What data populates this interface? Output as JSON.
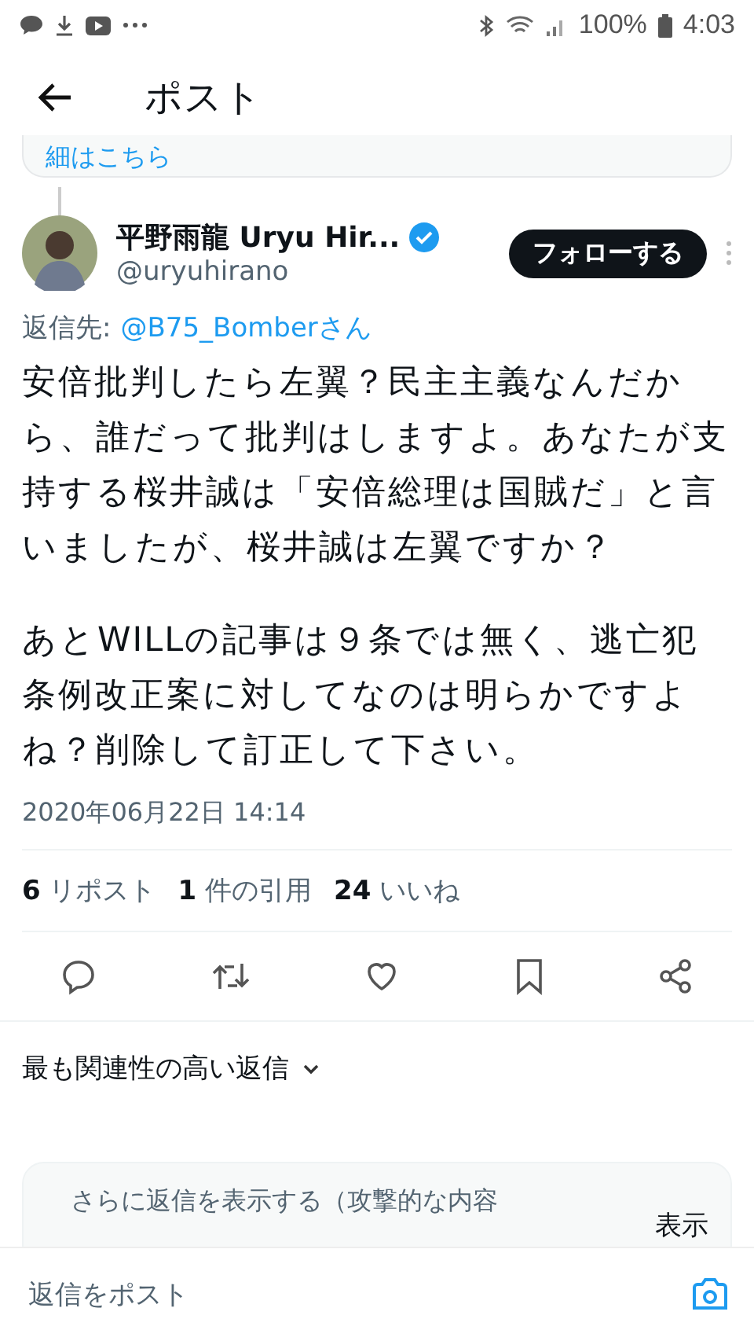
{
  "status_bar": {
    "time": "4:03",
    "battery": "100%"
  },
  "header": {
    "title": "ポスト"
  },
  "previous_card": {
    "link_text": "細はこちら"
  },
  "post": {
    "author_name": "平野雨龍 Uryu Hir...",
    "verified": true,
    "handle": "@uryuhirano",
    "follow_button": "フォローする",
    "reply_to_label": "返信先:",
    "reply_to_user": "@B75_Bomberさん",
    "paragraphs": [
      "安倍批判したら左翼？民主主義なんだから、誰だって批判はしますよ。あなたが支持する桜井誠は「安倍総理は国賊だ」と言いましたが、桜井誠は左翼ですか？",
      "あとWILLの記事は９条では無く、逃亡犯条例改正案に対してなのは明らかですよね？削除して訂正して下さい。"
    ],
    "timestamp": "2020年06月22日 14:14",
    "stats": [
      {
        "count": "6",
        "label": "リポスト"
      },
      {
        "count": "1",
        "label": "件の引用"
      },
      {
        "count": "24",
        "label": "いいね"
      }
    ]
  },
  "replies_sort": {
    "label": "最も関連性の高い返信"
  },
  "more_replies": {
    "text": "さらに返信を表示する（攻撃的な内容",
    "button": "表示"
  },
  "reply_bar": {
    "placeholder": "返信をポスト"
  }
}
